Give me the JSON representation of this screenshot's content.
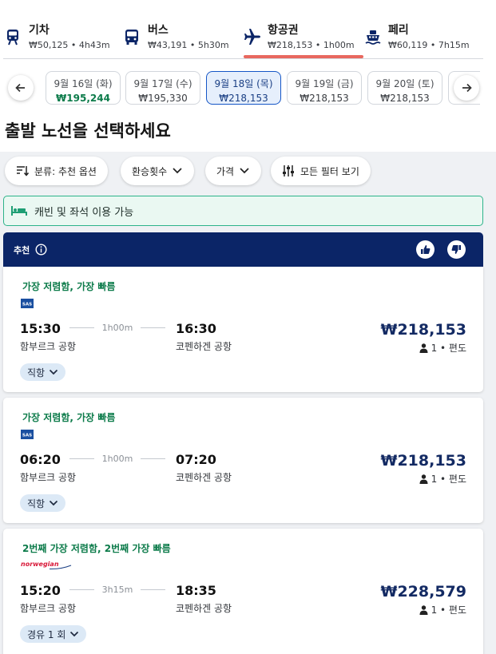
{
  "modes": [
    {
      "name": "기차",
      "sub": "₩50,125 • 4h43m",
      "icon": "train-icon"
    },
    {
      "name": "버스",
      "sub": "₩43,191 • 5h30m",
      "icon": "bus-icon"
    },
    {
      "name": "항공권",
      "sub": "₩218,153 • 1h00m",
      "icon": "plane-icon"
    },
    {
      "name": "페리",
      "sub": "₩60,119 • 7h15m",
      "icon": "ferry-icon"
    }
  ],
  "dates": [
    {
      "date": "9월 16일 (화)",
      "price": "₩195,244"
    },
    {
      "date": "9월 17일 (수)",
      "price": "₩195,330"
    },
    {
      "date": "9월 18일 (목)",
      "price": "₩218,153"
    },
    {
      "date": "9월 19일 (금)",
      "price": "₩218,153"
    },
    {
      "date": "9월 20일 (토)",
      "price": "₩218,153"
    }
  ],
  "heading": "출발 노선을 선택하세요",
  "filters": {
    "sort": "분류: 추천 옵션",
    "transfers": "환승횟수",
    "price": "가격",
    "all": "모든 필터 보기"
  },
  "cabin_note": "캐빈 및 좌석 이용 가능",
  "recommend_label": "추천",
  "flights": [
    {
      "tag": "가장 저렴함, 가장 빠름",
      "airline_logo": "SAS",
      "dep_time": "15:30",
      "duration": "1h00m",
      "arr_time": "16:30",
      "dep_airport": "함부르크 공항",
      "arr_airport": "코펜하겐 공항",
      "price": "₩218,153",
      "meta": "1 • 편도",
      "stops": "직항"
    },
    {
      "tag": "가장 저렴함, 가장 빠름",
      "airline_logo": "SAS",
      "dep_time": "06:20",
      "duration": "1h00m",
      "arr_time": "07:20",
      "dep_airport": "함부르크 공항",
      "arr_airport": "코펜하겐 공항",
      "price": "₩218,153",
      "meta": "1 • 편도",
      "stops": "직항"
    },
    {
      "tag": "2번째 가장 저렴함, 2번째 가장 빠름",
      "airline_logo": "norwegian",
      "dep_time": "15:20",
      "duration": "3h15m",
      "arr_time": "18:35",
      "dep_airport": "함부르크 공항",
      "arr_airport": "코펜하겐 공항",
      "price": "₩228,579",
      "meta": "1 • 편도",
      "stops": "경유 1 회"
    }
  ],
  "colors": {
    "navy": "#0b2567",
    "accent_red": "#e8685f",
    "green": "#0c7b4a",
    "selected_bg": "#e6effc"
  }
}
